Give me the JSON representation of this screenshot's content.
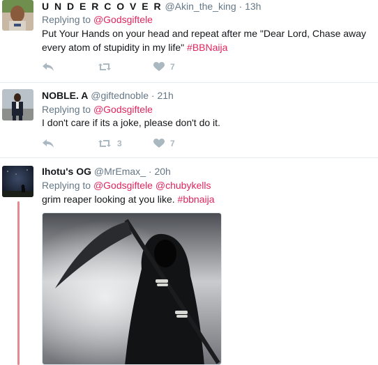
{
  "tweets": [
    {
      "display_name": "U N D E R C O V E R",
      "handle": "@Akin_the_king",
      "separator": "·",
      "time": "13h",
      "replying_prefix": "Replying to",
      "replying_to": [
        "@Godsgiftele"
      ],
      "text": "Put Your Hands on your head and repeat after me \"Dear Lord, Chase away every atom of stupidity in my life\"",
      "hashtag": "#BBNaija",
      "retweets": "",
      "likes": "7"
    },
    {
      "display_name": "NOBLE. A",
      "handle": "@giftednoble",
      "separator": "·",
      "time": "21h",
      "replying_prefix": "Replying to",
      "replying_to": [
        "@Godsgiftele"
      ],
      "text": "I don't care if its a joke, please don't do it.",
      "hashtag": "",
      "retweets": "3",
      "likes": "7"
    },
    {
      "display_name": "Ihotu's OG",
      "handle": "@MrEmax_",
      "separator": "·",
      "time": "20h",
      "replying_prefix": "Replying to",
      "replying_to": [
        "@Godsgiftele",
        "@chubykells"
      ],
      "text": "grim reaper looking at you like.",
      "hashtag": "#bbnaija",
      "retweets": "",
      "likes": ""
    }
  ],
  "icons": {
    "reply": "reply-arrow-icon",
    "retweet": "retweet-icon",
    "like": "heart-icon"
  },
  "colors": {
    "mention": "#e0245e",
    "muted": "#657786",
    "action_icon": "#aab8c2",
    "thread_line": "#e8878f"
  }
}
